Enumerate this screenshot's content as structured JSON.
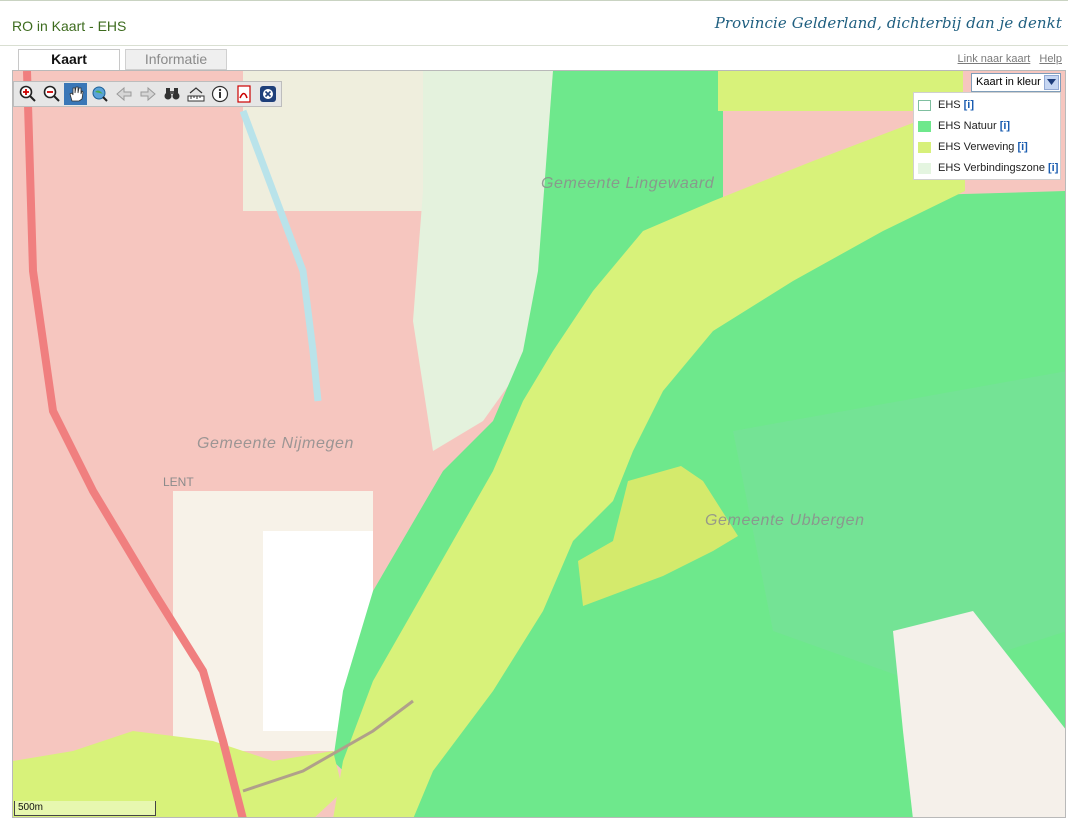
{
  "header": {
    "title": "RO in Kaart - EHS",
    "slogan": "Provincie Gelderland, dichterbij dan je denkt"
  },
  "tabs": [
    {
      "label": "Kaart",
      "active": true
    },
    {
      "label": "Informatie",
      "active": false
    }
  ],
  "top_links": {
    "link": "Link naar kaart",
    "help": "Help"
  },
  "toolbar": {
    "tools": [
      "zoom-in-icon",
      "zoom-out-icon",
      "pan-hand-icon",
      "zoom-extent-icon",
      "back-arrow-icon",
      "forward-arrow-icon",
      "binoculars-icon",
      "measure-icon",
      "info-icon",
      "pdf-icon",
      "close-circle-icon"
    ],
    "active_tool": "pan-hand-icon"
  },
  "map": {
    "layer_select": "Kaart in kleur",
    "labels": {
      "lingewaard": "Gemeente  Lingewaard",
      "nijmegen": "Gemeente  Nijmegen",
      "ubbergen": "Gemeente  Ubbergen",
      "lent": "LENT"
    },
    "scale": "500m"
  },
  "legend": {
    "items": [
      {
        "label": "EHS",
        "info": "[i]",
        "color": "#ffffff"
      },
      {
        "label": "EHS Natuur",
        "info": "[i]",
        "color": "#6ee88c"
      },
      {
        "label": "EHS Verweving",
        "info": "[i]",
        "color": "#d7f07a"
      },
      {
        "label": "EHS Verbindingszone",
        "info": "[i]",
        "color": "#e4f5e0"
      }
    ]
  },
  "colors": {
    "urban": "#f6c6bf",
    "road": "#f07f7f",
    "natuur": "#6ee88c",
    "verweving": "#d8f27a",
    "verbinding": "#e4f2dd",
    "title_green": "#3d6b1e",
    "slogan_blue": "#1f5f80"
  }
}
